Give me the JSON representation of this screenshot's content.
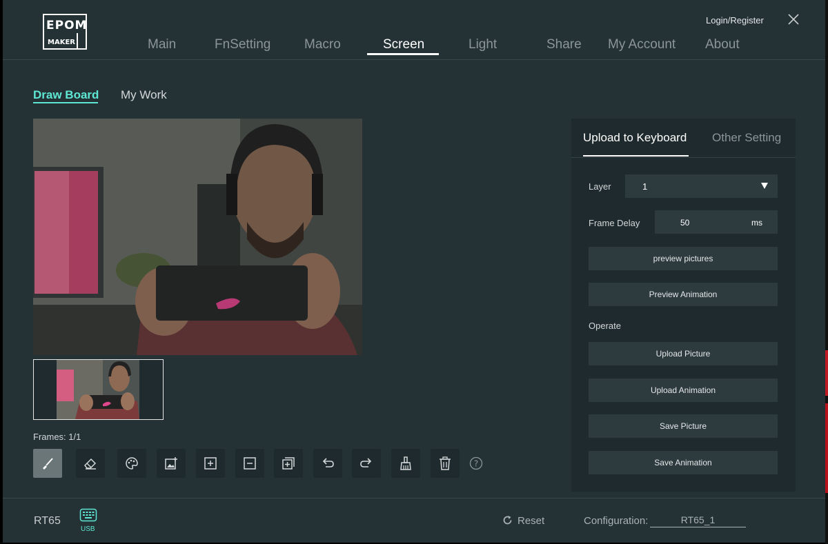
{
  "brand": {
    "logo_text": "EPOM MAKER"
  },
  "header": {
    "login": "Login/Register",
    "nav": [
      {
        "label": "Main"
      },
      {
        "label": "FnSetting"
      },
      {
        "label": "Macro"
      },
      {
        "label": "Screen",
        "active": true
      },
      {
        "label": "Light"
      },
      {
        "label": "Share"
      },
      {
        "label": "My Account"
      },
      {
        "label": "About"
      }
    ]
  },
  "subtabs": {
    "draw_board": "Draw Board",
    "my_work": "My Work",
    "active": "Draw Board"
  },
  "canvas": {
    "frames": "Frames: 1/1"
  },
  "toolbar": {
    "tools": [
      {
        "icon": "brush-icon",
        "active": true
      },
      {
        "icon": "eraser-icon"
      },
      {
        "icon": "palette-icon"
      },
      {
        "icon": "image-add-icon"
      },
      {
        "icon": "add-frame-icon"
      },
      {
        "icon": "remove-frame-icon"
      },
      {
        "icon": "copy-frame-icon"
      },
      {
        "icon": "undo-icon"
      },
      {
        "icon": "redo-icon"
      },
      {
        "icon": "clear-broom-icon"
      },
      {
        "icon": "trash-icon"
      }
    ]
  },
  "panel": {
    "tab_upload": "Upload to Keyboard",
    "tab_other": "Other Setting",
    "layer_label": "Layer",
    "layer_value": "1",
    "frame_delay_label": "Frame Delay",
    "frame_delay_value": "50",
    "frame_delay_unit": "ms",
    "preview_pictures": "preview pictures",
    "preview_animation": "Preview Animation",
    "operate_label": "Operate",
    "upload_picture": "Upload Picture",
    "upload_animation": "Upload Animation",
    "save_picture": "Save Picture",
    "save_animation": "Save Animation"
  },
  "footer": {
    "device": "RT65",
    "connection": "USB",
    "reset": "Reset",
    "config_label": "Configuration:",
    "config_value": "RT65_1"
  },
  "colors": {
    "accent": "#5ee7d3",
    "background": "#243236",
    "panel": "#1e2a2d",
    "button": "#2d3b3f"
  }
}
